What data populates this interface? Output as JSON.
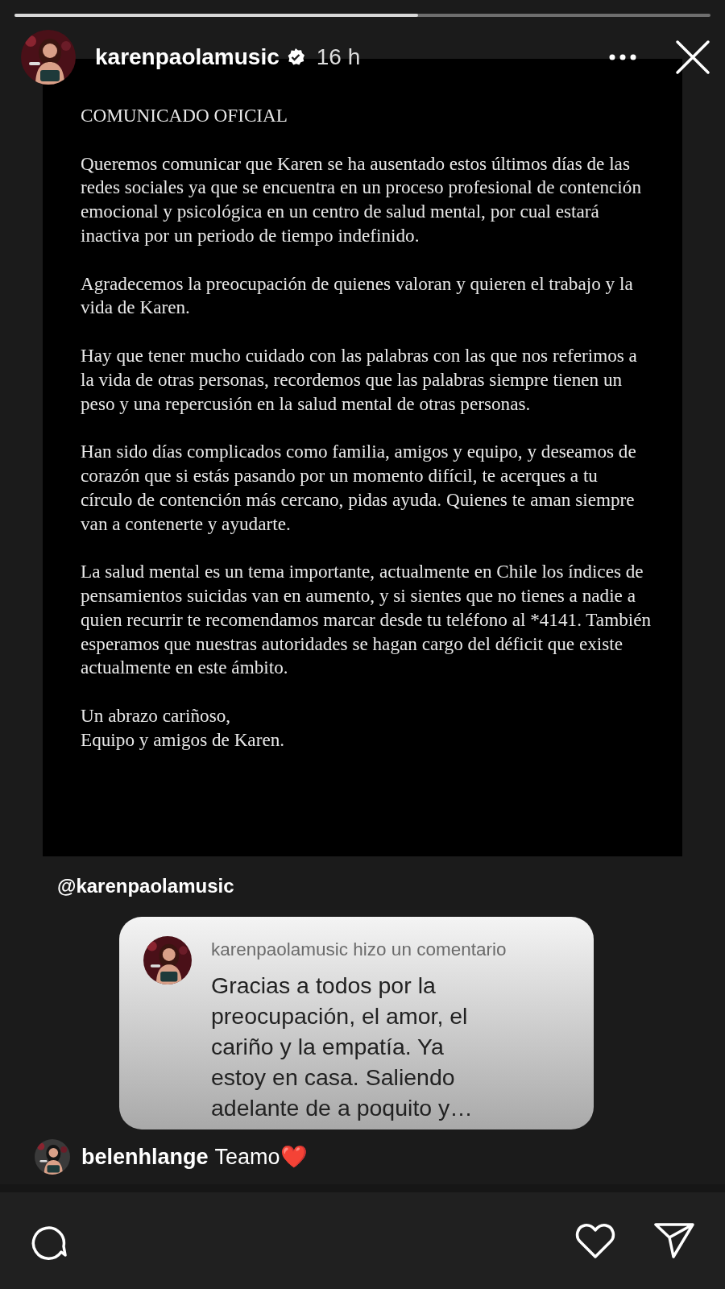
{
  "story_progress": {
    "level": 0.58
  },
  "header": {
    "username": "karenpaolamusic",
    "verified": true,
    "time": "16 h"
  },
  "post": {
    "title": "COMUNICADO OFICIAL",
    "paragraphs": [
      "Queremos comunicar que Karen se ha ausentado estos últimos días de las redes sociales ya que se encuentra en un proceso profesional de contención emocional y psicológica en un centro de salud mental, por cual estará inactiva por un periodo de tiempo indefinido.",
      "Agradecemos la preocupación de quienes valoran y quieren el trabajo y la vida de Karen.",
      "Hay que tener mucho cuidado con las palabras con las que nos referimos a la vida de otras personas, recordemos que las palabras siempre tienen un peso y una repercusión en la salud mental de otras personas.",
      "Han sido días complicados como familia, amigos y equipo, y deseamos de corazón que si estás pasando por un momento difícil, te acerques a tu círculo de contención más cercano, pidas ayuda. Quienes te aman siempre van a contenerte y ayudarte.",
      "La salud mental es un tema importante, actualmente en Chile los índices de pensamientos suicidas van en aumento, y si sientes que no tienes a nadie a quien recurrir te recomendamos marcar desde tu teléfono al *4141. También esperamos que nuestras autoridades se hagan cargo del déficit que existe actualmente en este ámbito.",
      "Un abrazo cariñoso,\nEquipo y amigos de Karen."
    ]
  },
  "mention": "@karenpaolamusic",
  "comment_card": {
    "author_line": "karenpaolamusic hizo un comentario",
    "text": "Gracias a todos por la preocupación, el amor, el cariño y la empatía. Ya estoy en casa. Saliendo adelante de a poquito y…"
  },
  "viewer_comment": {
    "username": "belenhlange",
    "text": "Teamo❤️"
  }
}
